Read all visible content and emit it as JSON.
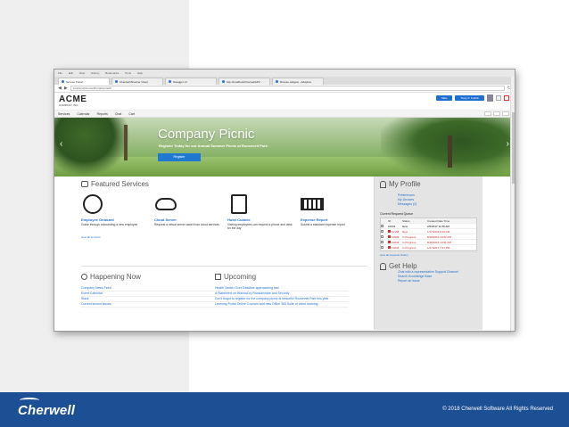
{
  "footer": {
    "logo": "Cherwell",
    "copyright": "© 2018 Cherwell Software All Rights Reserved"
  },
  "browser": {
    "menu": [
      "File",
      "Edit",
      "View",
      "History",
      "Bookmarks",
      "Tools",
      "Help"
    ],
    "tabs": [
      {
        "label": "Service Portal",
        "active": true
      },
      {
        "label": "Cherwell Browser Client",
        "active": false
      },
      {
        "label": "Swagger UI",
        "active": false
      },
      {
        "label": "http://localhost/CherwellAPI/...",
        "active": false
      },
      {
        "label": "Browse widgets - Adaptive",
        "active": false
      }
    ],
    "url": "localhost/CherwellPortal/portal/#"
  },
  "app": {
    "brand": "ACME",
    "brand_sub": "COMPANY, INC.",
    "user_pills": [
      "Mike",
      "Tracy F. Kudish"
    ],
    "menu": [
      "Services",
      "Calendar",
      "Reports",
      "Chat",
      "Cart"
    ]
  },
  "hero": {
    "title": "Company Picnic",
    "subtitle": "Register Today for our Annual Summer Picnic at Roosevelt Park",
    "button": "Register"
  },
  "featured": {
    "title": "Featured Services",
    "items": [
      {
        "icon": "person-icon",
        "name": "Employee Onboard",
        "desc": "Guide through onboarding a new employee"
      },
      {
        "icon": "cloud-icon",
        "name": "Cloud Server",
        "desc": "Request a virtual server asset from cloud services"
      },
      {
        "icon": "phone-icon",
        "name": "Hotel Cubicle",
        "desc": "Visiting employees can request a phone and desk for the day"
      },
      {
        "icon": "cash-icon",
        "name": "Expense Report",
        "desc": "Submit a standard expense report"
      }
    ],
    "view_all": "view all services"
  },
  "happening": {
    "title": "Happening Now",
    "items": [
      "Company News Feed",
      "Event Calendar",
      "Slack",
      "Current known issues"
    ]
  },
  "upcoming": {
    "title": "Upcoming",
    "items": [
      "Health Switch Over Deadline approaching fast",
      "A Statement on WannaCry Ransomware and Security",
      "Don't forget to register for the company picnic at beautiful Roosevelt Park this year",
      "Learning Portal Online Courses add new Office 365 Suite of video learning"
    ]
  },
  "profile": {
    "title": "My Profile",
    "links": [
      "Preferences",
      "My Devices",
      "Messages (2)"
    ],
    "queue_label": "Current Request Queue",
    "headers": [
      "ID",
      "Status",
      "Created Date Time"
    ],
    "rows": [
      {
        "id": "10231",
        "status": "New",
        "date": "2/6/2017 11:06 AM",
        "alert": false
      },
      {
        "id": "10158",
        "status": "New",
        "date": "1/17/2018 8:10 AM",
        "alert": true
      },
      {
        "id": "10035",
        "status": "In Progress",
        "date": "8/18/2016 10:52 PM",
        "alert": true
      },
      {
        "id": "10034",
        "status": "In Progress",
        "date": "8/18/2016 10:51 PM",
        "alert": true
      },
      {
        "id": "10033",
        "status": "In Progress",
        "date": "1/27/2017 7:47 PM",
        "alert": true
      }
    ],
    "view_all": "view all requests history"
  },
  "help": {
    "title": "Get Help",
    "links": [
      "Chat with a representative Support Channel",
      "Search Knowledge Base",
      "Report an issue"
    ]
  }
}
